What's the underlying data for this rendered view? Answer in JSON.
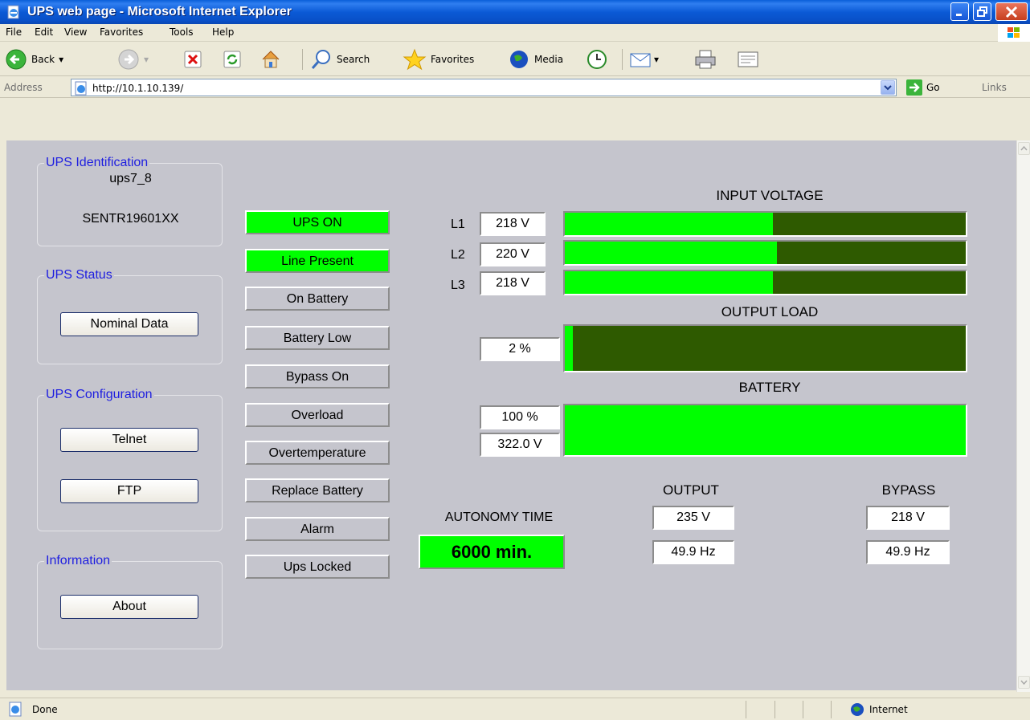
{
  "window": {
    "title": "UPS web page - Microsoft Internet Explorer"
  },
  "menu": [
    "File",
    "Edit",
    "View",
    "Favorites",
    "Tools",
    "Help"
  ],
  "toolbar": {
    "back": "Back",
    "search": "Search",
    "favorites": "Favorites",
    "media": "Media"
  },
  "address": {
    "label": "Address",
    "url": "http://10.1.10.139/",
    "go": "Go",
    "links": "Links"
  },
  "sidebar": {
    "identification": {
      "legend": "UPS Identification",
      "name": "ups7_8",
      "serial": "SENTR19601XX"
    },
    "status": {
      "legend": "UPS Status",
      "button": "Nominal Data"
    },
    "configuration": {
      "legend": "UPS Configuration",
      "telnet": "Telnet",
      "ftp": "FTP"
    },
    "information": {
      "legend": "Information",
      "about": "About"
    }
  },
  "indicators": [
    {
      "label": "UPS ON",
      "active": true
    },
    {
      "label": "Line Present",
      "active": true
    },
    {
      "label": "On Battery",
      "active": false
    },
    {
      "label": "Battery Low",
      "active": false
    },
    {
      "label": "Bypass On",
      "active": false
    },
    {
      "label": "Overload",
      "active": false
    },
    {
      "label": "Overtemperature",
      "active": false
    },
    {
      "label": "Replace Battery",
      "active": false
    },
    {
      "label": "Alarm",
      "active": false
    },
    {
      "label": "Ups Locked",
      "active": false
    }
  ],
  "input_voltage": {
    "heading": "INPUT VOLTAGE",
    "lines": [
      {
        "label": "L1",
        "value": "218 V",
        "fill": 0.52
      },
      {
        "label": "L2",
        "value": "220 V",
        "fill": 0.53
      },
      {
        "label": "L3",
        "value": "218 V",
        "fill": 0.52
      }
    ]
  },
  "output_load": {
    "heading": "OUTPUT LOAD",
    "value": "2 %",
    "fill": 0.02
  },
  "battery": {
    "heading": "BATTERY",
    "charge": "100 %",
    "voltage": "322.0 V",
    "fill": 1.0
  },
  "autonomy": {
    "label": "AUTONOMY TIME",
    "value": "6000 min."
  },
  "output": {
    "heading": "OUTPUT",
    "voltage": "235 V",
    "frequency": "49.9 Hz"
  },
  "bypass": {
    "heading": "BYPASS",
    "voltage": "218 V",
    "frequency": "49.9 Hz"
  },
  "statusbar": {
    "text": "Done",
    "zone": "Internet"
  },
  "colors": {
    "active": "#00ff00",
    "bar_bg": "#2e5a00",
    "legend": "#1e1ee0",
    "page_bg": "#c5c5cd"
  }
}
